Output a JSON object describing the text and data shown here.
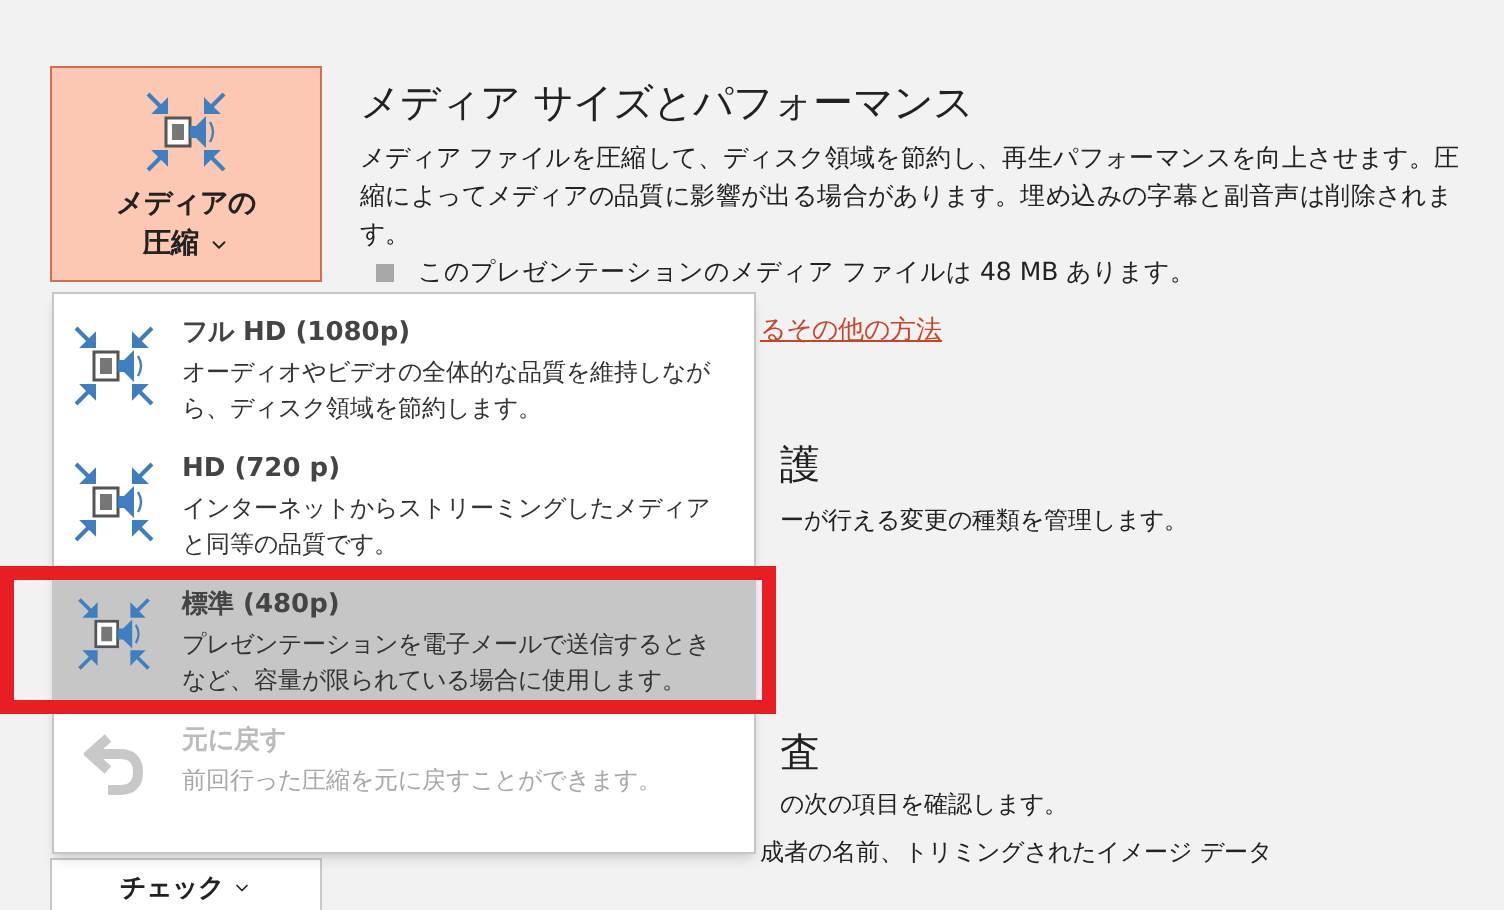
{
  "compress_button": {
    "label_lines": [
      "メディアの",
      "圧縮"
    ]
  },
  "section": {
    "title": "メディア サイズとパフォーマンス",
    "description": "メディア ファイルを圧縮して、ディスク領域を節約し、再生パフォーマンスを向上させます。圧縮によってメディアの品質に影響が出る場合があります。埋め込みの字幕と副音声は削除されます。",
    "bullet": "このプレゼンテーションのメディア ファイルは 48 MB あります。",
    "link": "るその他の方法"
  },
  "hidden_fragments": [
    {
      "kind": "heading",
      "text": "護"
    },
    {
      "kind": "text",
      "text": "ーが行える変更の種類を管理します。"
    },
    {
      "kind": "heading",
      "text": "査"
    },
    {
      "kind": "text",
      "text": "の次の項目を確認します。"
    },
    {
      "kind": "text",
      "text": "成者の名前、トリミングされたイメージ データ"
    }
  ],
  "check_button": {
    "label": "チェック"
  },
  "menu": {
    "items": [
      {
        "kind": "quality",
        "title": "フル HD (1080p)",
        "description": "オーディオやビデオの全体的な品質を維持しながら、ディスク領域を節約します。",
        "selected": false,
        "disabled": false
      },
      {
        "kind": "quality",
        "title": "HD (720 p)",
        "description": "インターネットからストリーミングしたメディアと同等の品質です。",
        "selected": false,
        "disabled": false
      },
      {
        "kind": "quality",
        "title": "標準 (480p)",
        "description": "プレゼンテーションを電子メールで送信するときなど、容量が限られている場合に使用します。",
        "selected": true,
        "disabled": false
      },
      {
        "kind": "undo",
        "title": "元に戻す",
        "description": "前回行った圧縮を元に戻すことができます。",
        "selected": false,
        "disabled": true
      }
    ]
  },
  "highlight": {
    "color": "#e81e25"
  }
}
